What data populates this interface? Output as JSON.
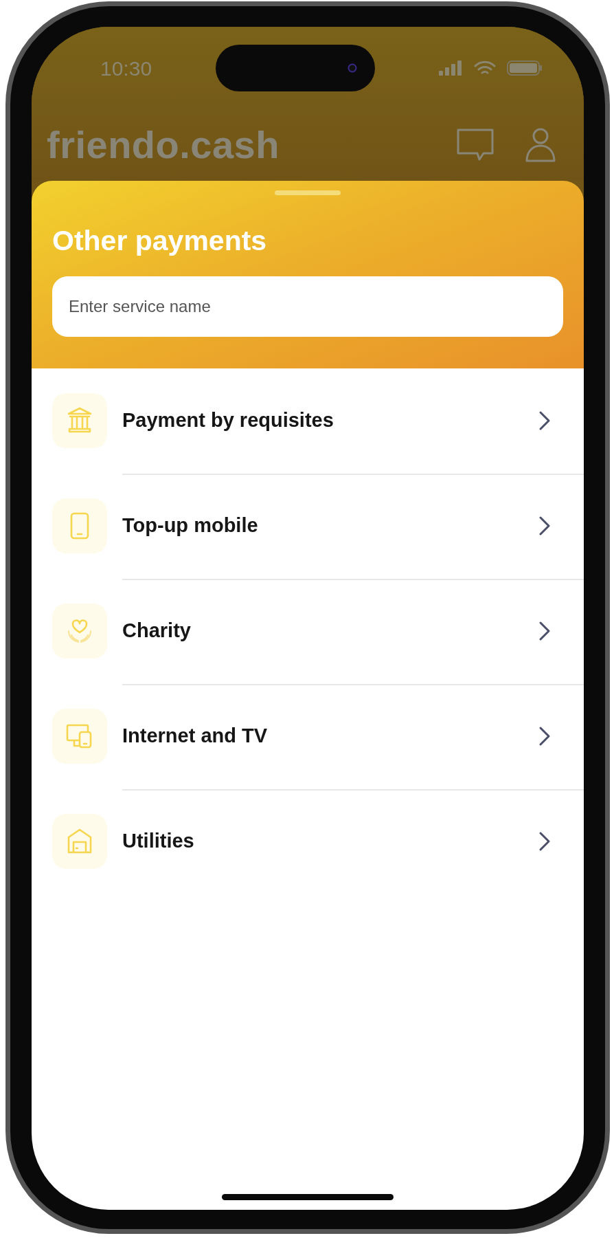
{
  "status_bar": {
    "time": "10:30"
  },
  "header": {
    "logo": "friendo.cash"
  },
  "sheet": {
    "title": "Other payments",
    "search": {
      "placeholder": "Enter service name"
    }
  },
  "services": [
    {
      "label": "Payment by requisites",
      "kind": "bank"
    },
    {
      "label": "Top-up mobile",
      "kind": "phone"
    },
    {
      "label": "Charity",
      "kind": "charity"
    },
    {
      "label": "Internet and TV",
      "kind": "devices"
    },
    {
      "label": "Utilities",
      "kind": "house"
    }
  ]
}
